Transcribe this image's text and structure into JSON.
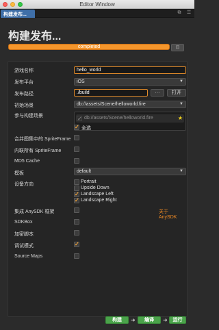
{
  "window": {
    "title": "Editor Window"
  },
  "tab": {
    "label": "构建发布..."
  },
  "tab_icons": [
    "popout-icon",
    "menu-icon"
  ],
  "panel": {
    "title": "构建发布..."
  },
  "progress": {
    "label": "completed",
    "percent": 100
  },
  "form": {
    "game_name": {
      "label": "游戏名称",
      "value": "hello_world"
    },
    "platform": {
      "label": "发布平台",
      "value": "iOS"
    },
    "path": {
      "label": "发布路径",
      "value": "./build",
      "browse_label": "···",
      "open_label": "打开"
    },
    "start_scene": {
      "label": "初始场景",
      "value": "db://assets/Scene/helloworld.fire"
    },
    "scenes": {
      "label": "参与构建场景",
      "item": "db://assets/Scene/helloworld.fire",
      "select_all": "全选"
    },
    "merge_atlas": {
      "label": "合并图集中的 SpriteFrame",
      "checked": false
    },
    "inline_sprite": {
      "label": "内联所有 SpriteFrame",
      "checked": false
    },
    "md5": {
      "label": "MD5 Cache",
      "checked": false
    },
    "template": {
      "label": "模板",
      "value": "default"
    },
    "orientation": {
      "label": "设备方向",
      "options": [
        {
          "label": "Portrait",
          "checked": false
        },
        {
          "label": "Upside Down",
          "checked": false
        },
        {
          "label": "Landscape Left",
          "checked": true
        },
        {
          "label": "Landscape Right",
          "checked": true
        }
      ]
    },
    "anysdk": {
      "label": "集成 AnySDK 框架",
      "checked": false,
      "link": "关于 AnySDK"
    },
    "sdkbox": {
      "label": "SDKBox",
      "checked": false
    },
    "encrypt": {
      "label": "加密脚本",
      "checked": false
    },
    "debug": {
      "label": "调试模式",
      "checked": true
    },
    "source_maps": {
      "label": "Source Maps",
      "checked": false
    }
  },
  "actions": {
    "build": "构建",
    "compile": "编译",
    "run": "运行"
  },
  "colors": {
    "accent": "#f08a24",
    "action_green": "#4aa34a",
    "tab_blue": "#3f6fa8"
  }
}
